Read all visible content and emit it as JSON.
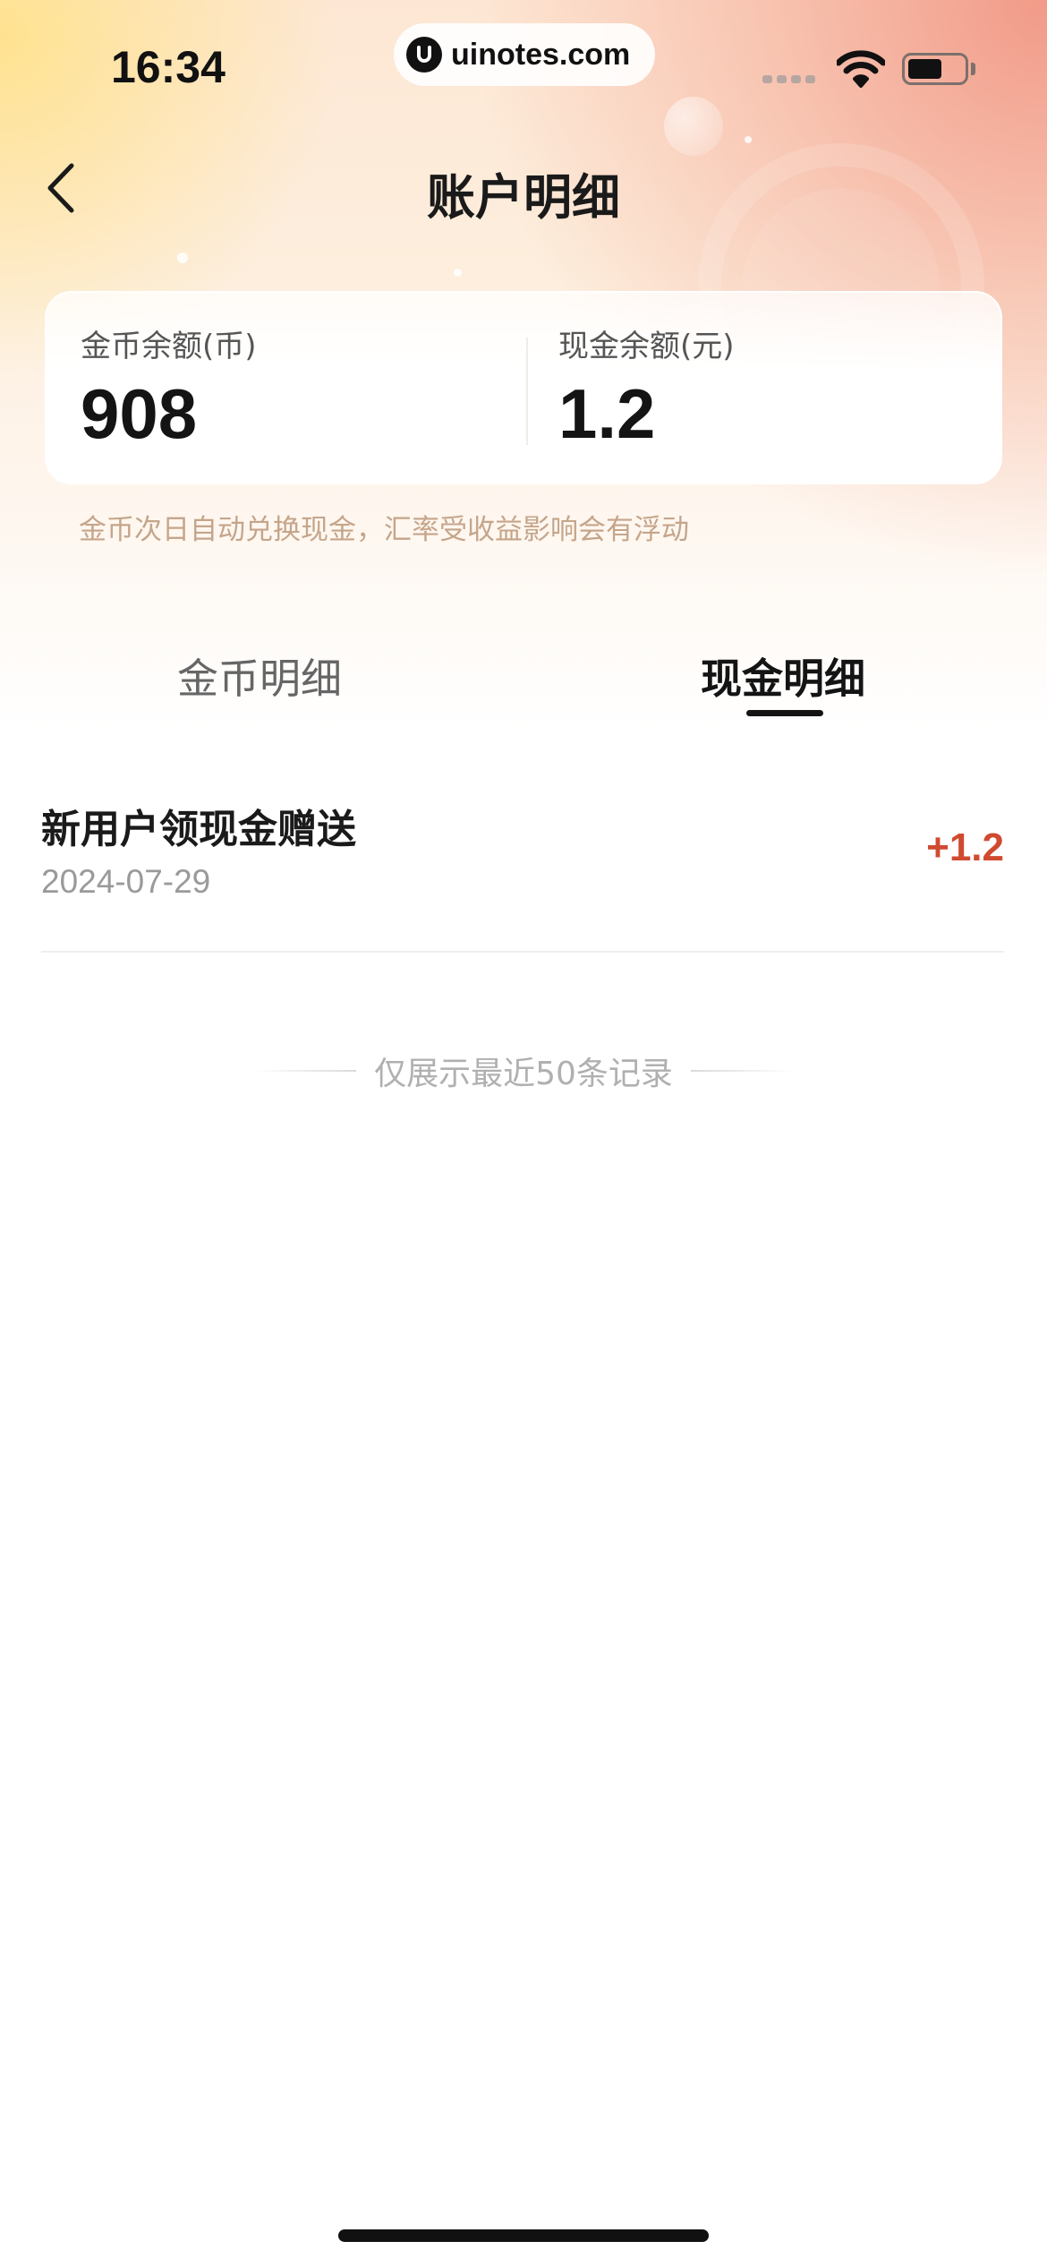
{
  "status_bar": {
    "time": "16:34",
    "url": "uinotes.com"
  },
  "nav": {
    "title": "账户明细"
  },
  "balance": {
    "coin_label": "金币余额(币)",
    "coin_value": "908",
    "cash_label": "现金余额(元)",
    "cash_value": "1.2",
    "note": "金币次日自动兑换现金，汇率受收益影响会有浮动"
  },
  "tabs": [
    {
      "label": "金币明细",
      "active": false
    },
    {
      "label": "现金明细",
      "active": true
    }
  ],
  "records": [
    {
      "title": "新用户领现金赠送",
      "date": "2024-07-29",
      "amount": "+1.2"
    }
  ],
  "footer_note": "仅展示最近50条记录",
  "colors": {
    "amount": "#d04a30",
    "note": "#c5a58a"
  }
}
